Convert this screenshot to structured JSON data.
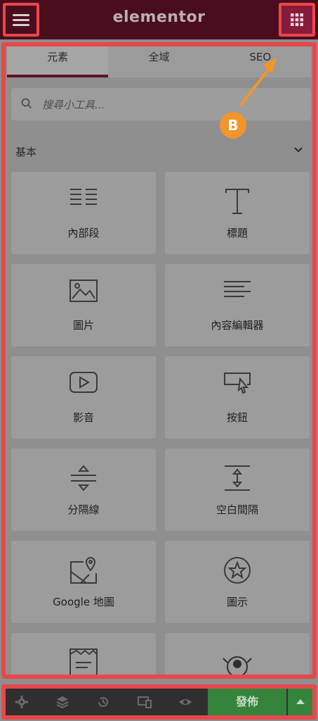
{
  "header": {
    "brand": "elementor",
    "menu_icon": "hamburger-icon",
    "grid_icon": "grid-icon"
  },
  "tabs": [
    {
      "label": "元素",
      "active": true
    },
    {
      "label": "全域",
      "active": false
    },
    {
      "label": "SEO",
      "active": false
    }
  ],
  "search": {
    "placeholder": "搜尋小工具..."
  },
  "section": {
    "title": "基本"
  },
  "widgets": [
    {
      "label": "內部段",
      "icon": "inner-section-icon"
    },
    {
      "label": "標題",
      "icon": "heading-icon"
    },
    {
      "label": "圖片",
      "icon": "image-icon"
    },
    {
      "label": "內容編輯器",
      "icon": "text-editor-icon"
    },
    {
      "label": "影音",
      "icon": "video-icon"
    },
    {
      "label": "按鈕",
      "icon": "button-icon"
    },
    {
      "label": "分隔線",
      "icon": "divider-icon"
    },
    {
      "label": "空白間隔",
      "icon": "spacer-icon"
    },
    {
      "label": "Google 地圖",
      "icon": "google-maps-icon"
    },
    {
      "label": "圖示",
      "icon": "star-icon"
    },
    {
      "label": "",
      "icon": "form-icon"
    },
    {
      "label": "",
      "icon": "mascot-icon"
    }
  ],
  "annotation": {
    "badge": "B",
    "color": "#f2952a"
  },
  "footer": {
    "publish_label": "發佈",
    "icons": [
      "gear-icon",
      "layers-icon",
      "history-icon",
      "responsive-icon",
      "eye-icon"
    ]
  },
  "colors": {
    "frame": "#e8474c",
    "header": "#4a0d1e",
    "publish": "#35843b"
  }
}
